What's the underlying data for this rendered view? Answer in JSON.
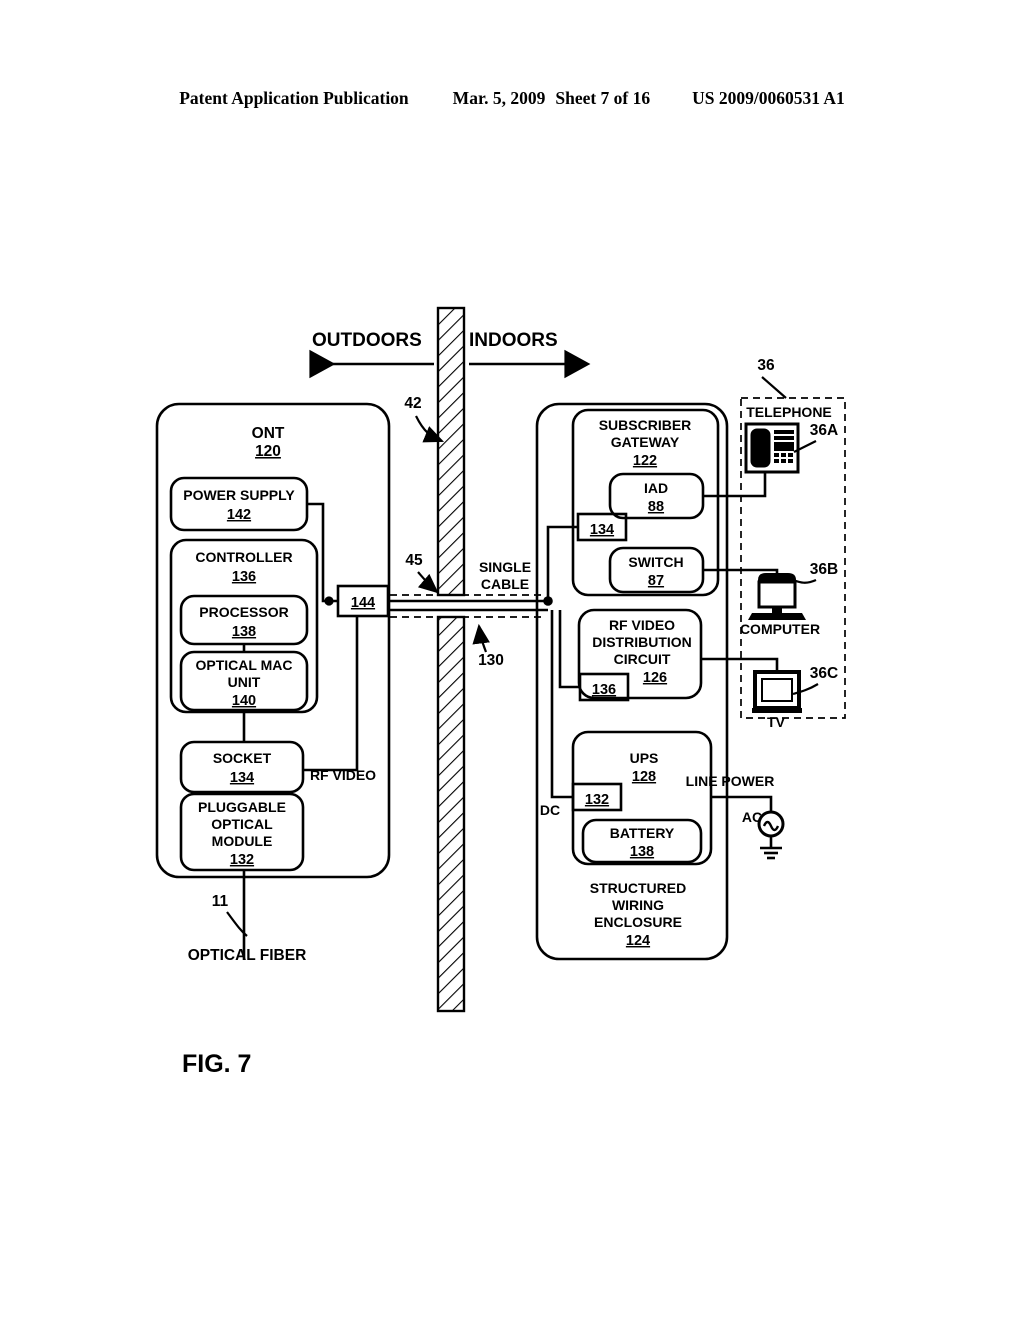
{
  "header": {
    "publication": "Patent Application Publication",
    "date": "Mar. 5, 2009",
    "sheet": "Sheet 7 of 16",
    "number": "US 2009/0060531 A1"
  },
  "figure": {
    "caption": "FIG. 7",
    "outdoors_label": "OUTDOORS",
    "indoors_label": "INDOORS"
  },
  "ont": {
    "title": "ONT",
    "ref": "120",
    "power_supply": {
      "label": "POWER SUPPLY",
      "ref": "142"
    },
    "controller": {
      "label": "CONTROLLER",
      "ref": "136"
    },
    "processor": {
      "label": "PROCESSOR",
      "ref": "138"
    },
    "optical_mac": {
      "line1": "OPTICAL MAC",
      "line2": "UNIT",
      "ref": "140"
    },
    "socket": {
      "label": "SOCKET",
      "ref": "134"
    },
    "pluggable_module": {
      "line1": "PLUGGABLE",
      "line2": "OPTICAL",
      "line3": "MODULE",
      "ref": "132"
    },
    "connector_144": "144",
    "rf_video_label": "RF VIDEO",
    "optical_fiber_label": "OPTICAL FIBER",
    "fiber_ref": "11"
  },
  "wall": {
    "ref": "42",
    "cable_ref": "45",
    "cable_label_line1": "SINGLE",
    "cable_label_line2": "CABLE",
    "conduit_ref": "130"
  },
  "enclosure": {
    "title_line1": "STRUCTURED",
    "title_line2": "WIRING",
    "title_line3": "ENCLOSURE",
    "ref": "124",
    "gateway": {
      "line1": "SUBSCRIBER",
      "line2": "GATEWAY",
      "ref": "122"
    },
    "iad": {
      "label": "IAD",
      "ref": "88"
    },
    "switch": {
      "label": "SWITCH",
      "ref": "87"
    },
    "port_134": "134",
    "rf_video": {
      "line1": "RF VIDEO",
      "line2": "DISTRIBUTION",
      "line3": "CIRCUIT",
      "ref": "126"
    },
    "port_136": "136",
    "ups": {
      "label": "UPS",
      "ref": "128"
    },
    "port_132": "132",
    "battery": {
      "label": "BATTERY",
      "ref": "138"
    },
    "dc_label": "DC"
  },
  "devices": {
    "group_ref": "36",
    "telephone": {
      "label": "TELEPHONE",
      "ref": "36A",
      "icon": "telephone-icon"
    },
    "computer": {
      "label": "COMPUTER",
      "ref": "36B",
      "icon": "computer-icon"
    },
    "tv": {
      "label": "TV",
      "ref": "36C",
      "icon": "tv-icon"
    }
  },
  "power": {
    "line_power_label": "LINE POWER",
    "ac_label": "AC",
    "ac_icon": "ac-source-icon",
    "ground_icon": "ground-icon"
  }
}
